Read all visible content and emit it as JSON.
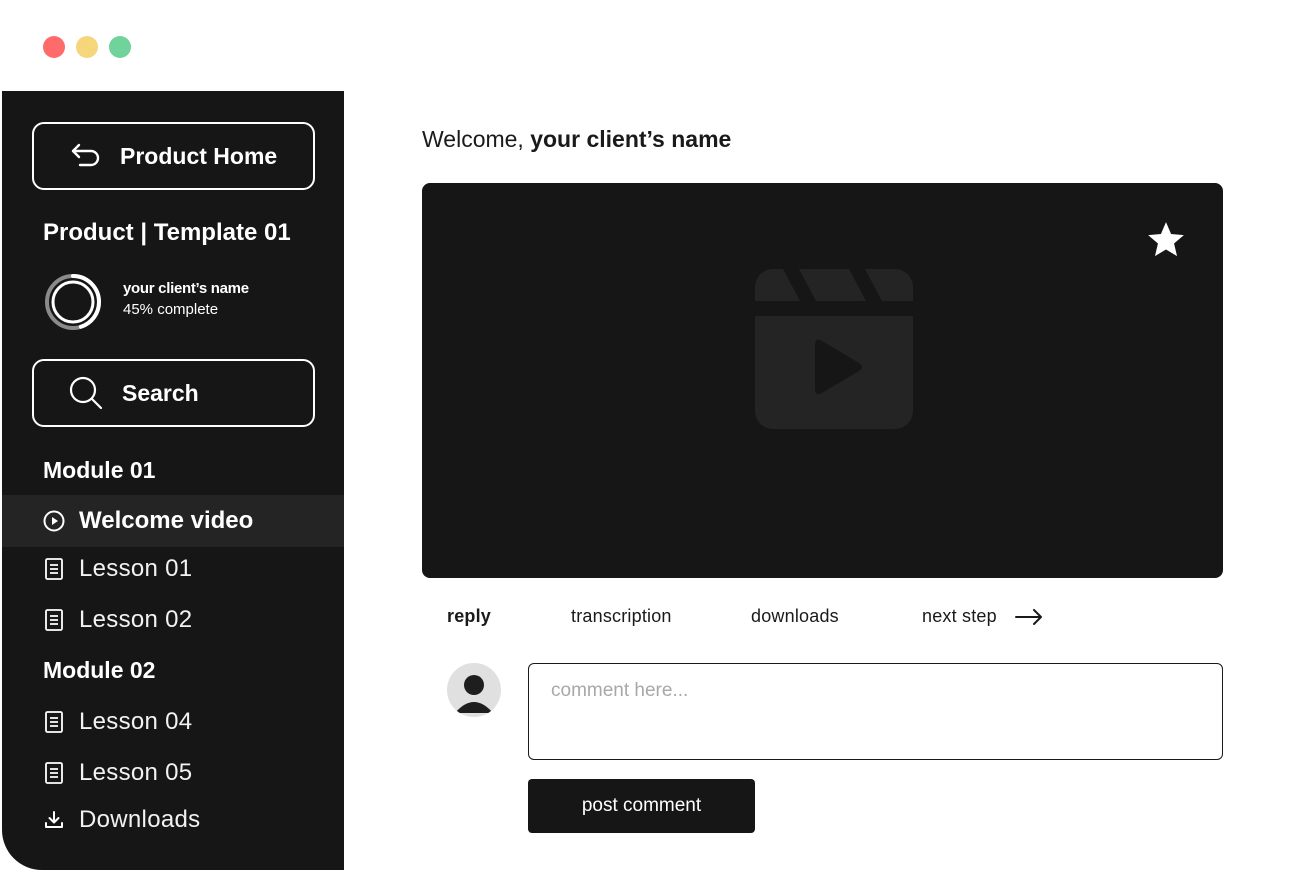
{
  "window": {
    "controls": [
      "close",
      "minimize",
      "maximize"
    ],
    "colors": {
      "close": "#ff6b6b",
      "minimize": "#f5d67a",
      "maximize": "#6fd39b"
    }
  },
  "sidebar": {
    "home_button": {
      "label": "Product Home",
      "icon": "back-arrow-icon"
    },
    "product_title": "Product | Template 01",
    "progress": {
      "name": "your client’s name",
      "label": "45% complete",
      "percent": 45
    },
    "search_button": {
      "label": "Search",
      "icon": "search-icon"
    },
    "modules": [
      {
        "title": "Module 01",
        "items": [
          {
            "label": "Welcome video",
            "icon": "play-circle-icon",
            "active": true
          },
          {
            "label": "Lesson 01",
            "icon": "document-icon"
          },
          {
            "label": "Lesson 02",
            "icon": "document-icon"
          }
        ]
      },
      {
        "title": "Module 02",
        "items": [
          {
            "label": "Lesson 04",
            "icon": "document-icon"
          },
          {
            "label": "Lesson 05",
            "icon": "document-icon"
          },
          {
            "label": "Downloads",
            "icon": "download-icon"
          }
        ]
      }
    ]
  },
  "main": {
    "welcome_prefix": "Welcome, ",
    "client_name": "your client’s name",
    "video": {
      "icons": [
        "star-icon",
        "video-clapper-icon"
      ]
    },
    "tabs": [
      {
        "label": "reply",
        "active": true
      },
      {
        "label": "transcription"
      },
      {
        "label": "downloads"
      },
      {
        "label": "next step",
        "icon": "arrow-right-icon"
      }
    ],
    "comment": {
      "placeholder": "comment here...",
      "value": ""
    },
    "post_button": "post comment"
  },
  "colors": {
    "sidebar_bg": "#161616",
    "active_item_bg": "#242424",
    "video_bg": "#161616",
    "placeholder": "#a8a8a8"
  }
}
